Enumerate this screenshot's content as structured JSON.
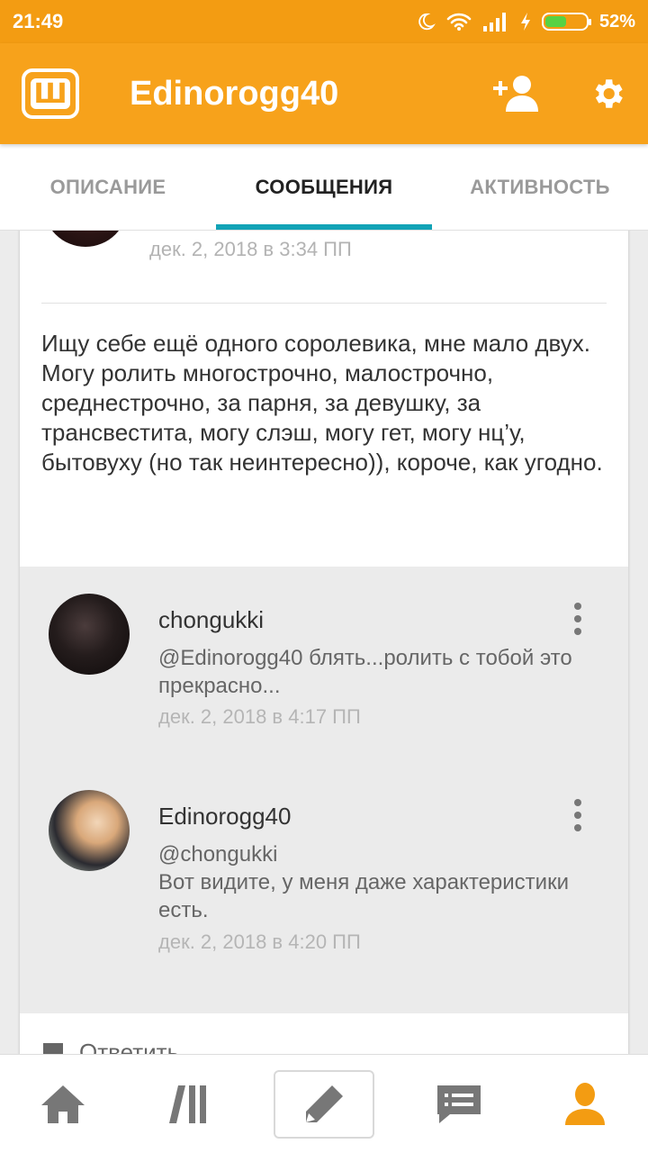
{
  "status_bar": {
    "time": "21:49",
    "battery_percent": "52%",
    "battery_level": 0.52,
    "icons": [
      "moon-icon",
      "wifi-icon",
      "signal-icon",
      "charging-icon",
      "battery-icon"
    ]
  },
  "app_bar": {
    "logo_letter": "Ш",
    "title": "Edinorogg40",
    "icons": [
      "add-user-icon",
      "gear-icon"
    ],
    "brand_color": "#f7a21b"
  },
  "tabs": [
    {
      "label": "ОПИСАНИЕ",
      "active": false
    },
    {
      "label": "СООБЩЕНИЯ",
      "active": true
    },
    {
      "label": "АКТИВНОСТЬ",
      "active": false
    }
  ],
  "post": {
    "date": "дек. 2, 2018 в 3:34 ПП",
    "body": "Ищу себе ещё одного соролевика, мне мало двух.\nМогу ролить многострочно, малострочно, среднестрочно, за парня, за девушку, за трансвестита, могу слэш, могу гет, могу нц’у, бытовуху (но так неинтересно)), короче, как угодно."
  },
  "comments": [
    {
      "author": "chongukki",
      "text": "@Edinorogg40  блять...ролить с тобой это прекрасно...",
      "date": "дек. 2, 2018 в 4:17 ПП"
    },
    {
      "author": "Edinorogg40",
      "text": "@chongukki\nВот видите, у меня даже характеристики есть.",
      "date": "дек. 2, 2018 в 4:20 ПП"
    }
  ],
  "reply": {
    "label": "Ответить",
    "icon": "comment-icon"
  },
  "bottom_nav": {
    "items": [
      "home-icon",
      "library-icon",
      "pencil-icon",
      "messages-icon",
      "profile-icon"
    ],
    "active": "profile-icon",
    "active_color": "#f39c12"
  }
}
